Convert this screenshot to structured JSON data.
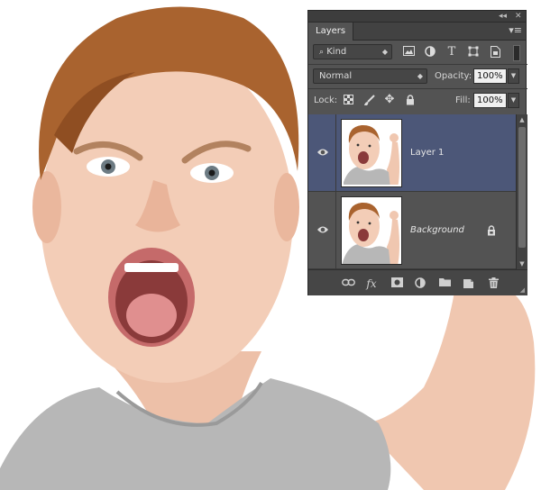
{
  "panel": {
    "title_controls": {
      "collapse": "◂◂",
      "close": "✕"
    },
    "tab_label": "Layers",
    "menu_icon": "panel-menu-icon",
    "filter": {
      "label": "Kind",
      "icons": [
        "image-filter-icon",
        "adjustment-filter-icon",
        "type-filter-icon",
        "shape-filter-icon",
        "smart-object-filter-icon"
      ]
    },
    "blend_mode": "Normal",
    "opacity_label": "Opacity:",
    "opacity_value": "100%",
    "lock_label": "Lock:",
    "lock_icons": [
      "lock-transparent-icon",
      "lock-image-icon",
      "lock-position-icon",
      "lock-all-icon"
    ],
    "fill_label": "Fill:",
    "fill_value": "100%",
    "layers": [
      {
        "name": "Layer 1",
        "selected": true,
        "visible": true,
        "locked": false
      },
      {
        "name": "Background",
        "selected": false,
        "visible": true,
        "locked": true
      }
    ],
    "footer_icons": [
      "link-layers-icon",
      "fx-icon",
      "layer-mask-icon",
      "adjustment-layer-icon",
      "new-group-icon",
      "new-layer-icon",
      "delete-layer-icon"
    ],
    "fx_label": "fx"
  },
  "colors": {
    "panel_bg": "#535353",
    "selected_layer": "#4c5778",
    "skin": "#f1c9b3",
    "hair": "#a8632e",
    "shirt": "#b9b9b9"
  }
}
